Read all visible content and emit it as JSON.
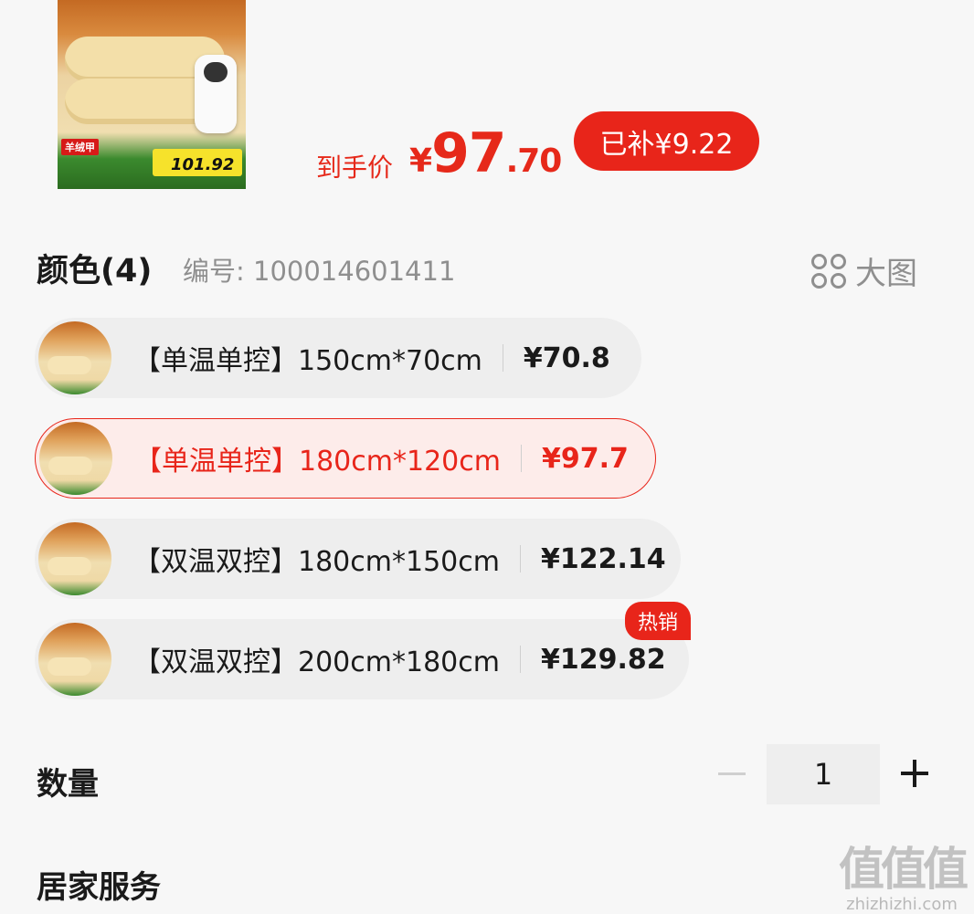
{
  "product": {
    "image_alt": "电热毯",
    "image_brand_text": "羊绒甲",
    "image_badge_text": "101.92"
  },
  "price": {
    "label": "到手价",
    "currency": "¥",
    "integer": "97",
    "decimal": ".70",
    "subsidy": "已补¥9.22"
  },
  "color_section": {
    "title": "颜色(4)",
    "sku": "编号: 100014601411",
    "big_pic_label": "大图"
  },
  "options": [
    {
      "label": "【单温单控】150cm*70cm",
      "price": "¥70.8",
      "selected": false
    },
    {
      "label": "【单温单控】180cm*120cm",
      "price": "¥97.7",
      "selected": true
    },
    {
      "label": "【双温双控】180cm*150cm",
      "price": "¥122.14",
      "selected": false
    },
    {
      "label": "【双温双控】200cm*180cm",
      "price": "¥129.82",
      "selected": false,
      "tag": "热销"
    }
  ],
  "quantity": {
    "label": "数量",
    "value": "1"
  },
  "home_service": {
    "label": "居家服务"
  },
  "watermark": {
    "big": "值值值",
    "small": "zhizhizhi.com"
  },
  "colors": {
    "accent": "#e8251a",
    "selected_bg": "#fdecea",
    "pill_bg": "#eeeeee",
    "muted_text": "#8f8f8f"
  }
}
